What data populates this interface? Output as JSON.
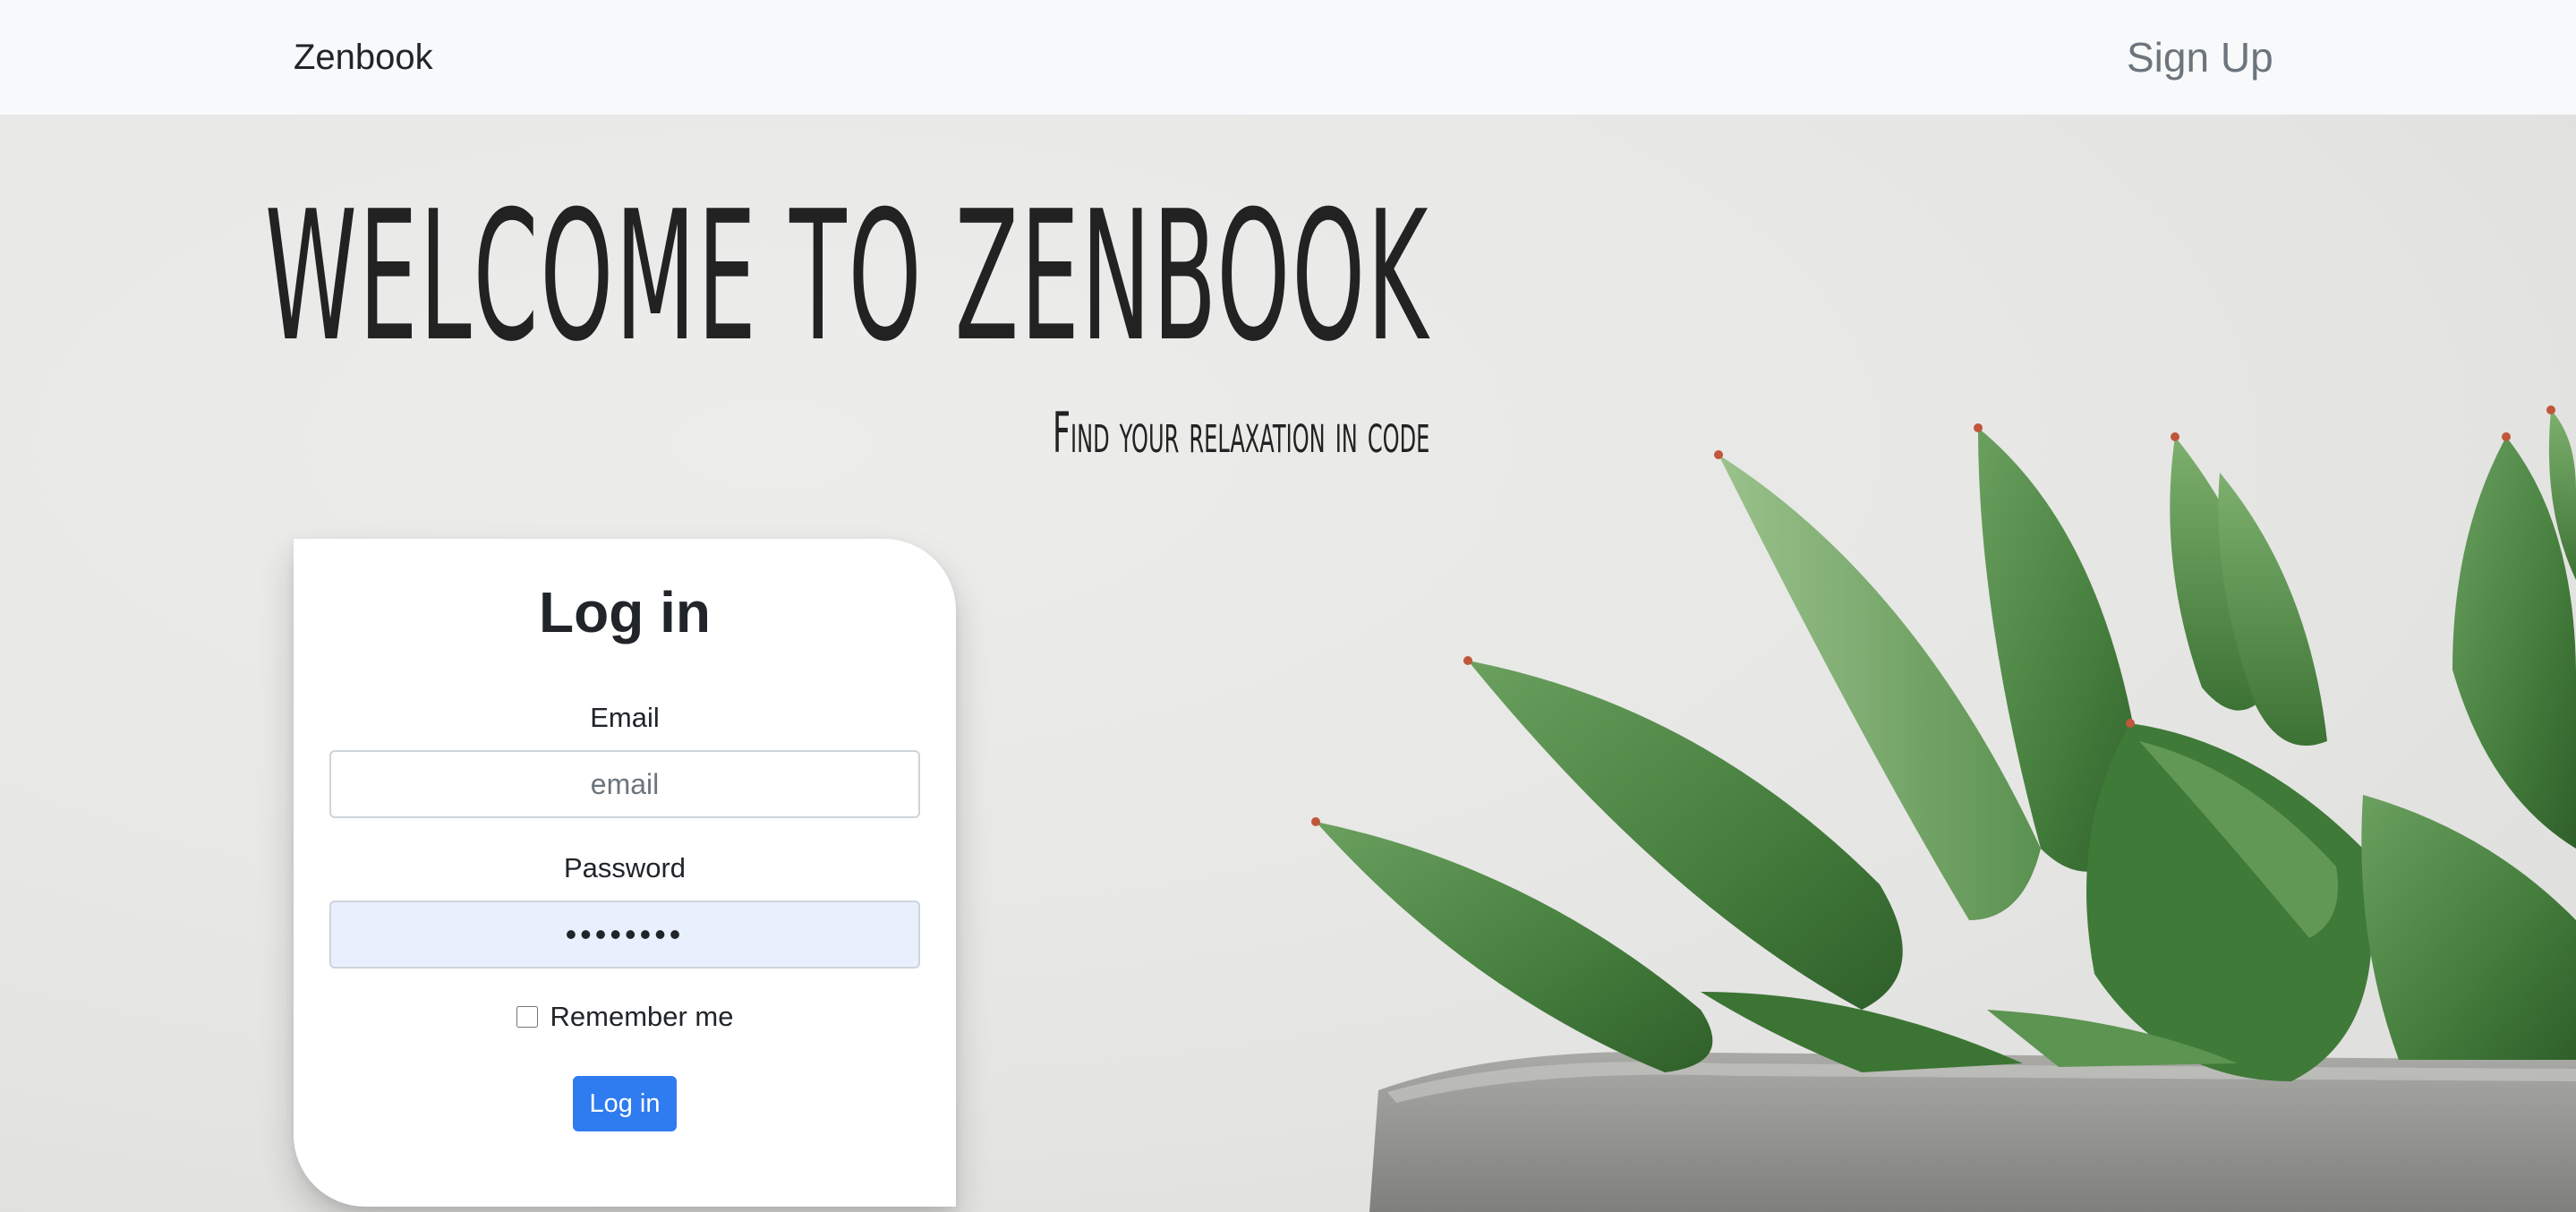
{
  "navbar": {
    "brand": "Zenbook",
    "signup_label": "Sign Up"
  },
  "hero": {
    "title": "Welcome to Zenbook",
    "subtitle": "Find your relaxation in code"
  },
  "login_card": {
    "title": "Log in",
    "email_label": "Email",
    "email_placeholder": "email",
    "email_value": "",
    "password_label": "Password",
    "password_value": "••••••••",
    "remember_label": "Remember me",
    "remember_checked": false,
    "submit_label": "Log in"
  },
  "colors": {
    "navbar_bg": "#f8f9fa",
    "primary_button": "#2f7bf0",
    "autofill_bg": "#e8f0fe",
    "plant_green": "#4f8a45"
  }
}
